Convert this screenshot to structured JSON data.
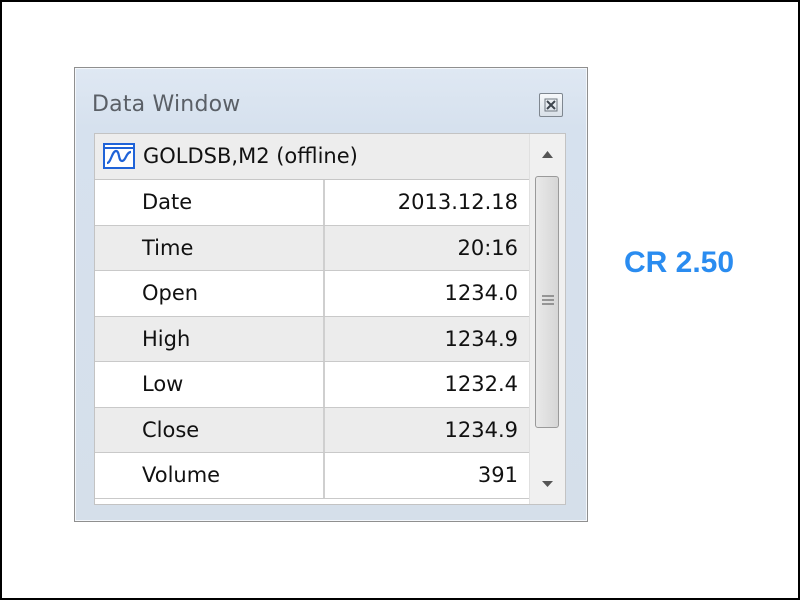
{
  "window": {
    "title": "Data Window",
    "close_icon": "close-icon"
  },
  "symbol": {
    "icon": "chart-icon",
    "label": "GOLDSB,M2 (offline)"
  },
  "rows": [
    {
      "name": "Date",
      "value": "2013.12.18"
    },
    {
      "name": "Time",
      "value": "20:16"
    },
    {
      "name": "Open",
      "value": "1234.0"
    },
    {
      "name": "High",
      "value": "1234.9"
    },
    {
      "name": "Low",
      "value": "1232.4"
    },
    {
      "name": "Close",
      "value": "1234.9"
    },
    {
      "name": "Volume",
      "value": "391"
    }
  ],
  "scrollbar": {
    "up_icon": "scroll-up-arrow-icon",
    "down_icon": "scroll-down-arrow-icon",
    "grip_icon": "grip-icon"
  },
  "annotation": {
    "text": "CR 2.50",
    "color": "#2a8cf0"
  },
  "colors": {
    "window_background": "#d6e1ee",
    "row_alt": "#ececec",
    "row_plain": "#ffffff",
    "icon_blue": "#1f63d8"
  }
}
